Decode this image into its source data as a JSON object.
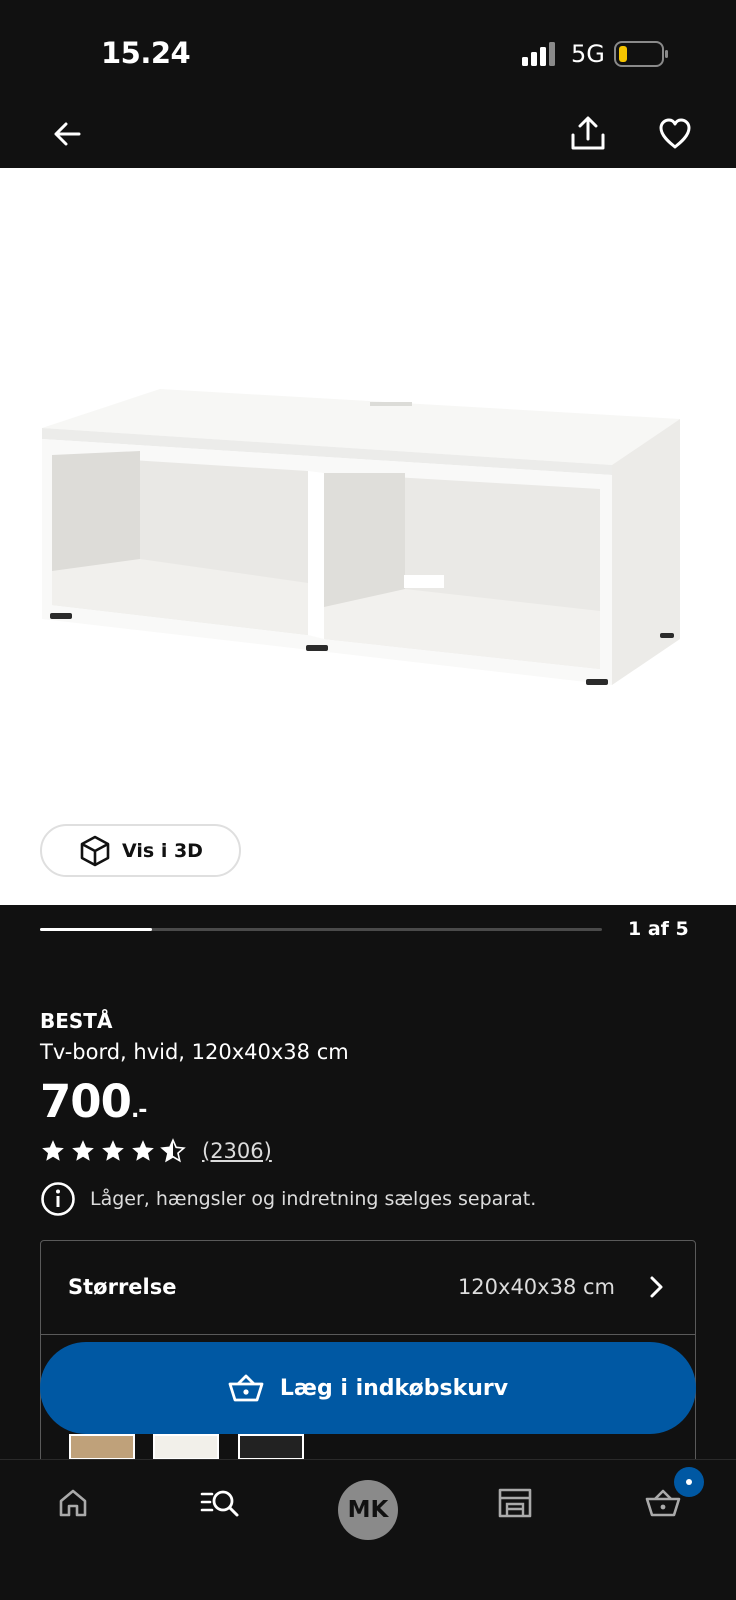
{
  "status_bar": {
    "time": "15.24",
    "network": "5G"
  },
  "gallery": {
    "view_3d_label": "Vis i 3D",
    "page_counter": "1 af 5",
    "progress": 0.2
  },
  "product": {
    "brand": "BESTÅ",
    "description": "Tv-bord, hvid, 120x40x38 cm",
    "price": "700",
    "price_suffix": ".-",
    "rating": 4.5,
    "review_count": "(2306)",
    "notice": "Låger, hængsler og indretning sælges separat."
  },
  "size_selector": {
    "label": "Størrelse",
    "value": "120x40x38 cm"
  },
  "color_swatches": [
    "oak-effect",
    "white",
    "black"
  ],
  "cart_button": {
    "label": "Læg i indkøbskurv"
  },
  "bottom_nav": {
    "avatar_initials": "MK"
  },
  "colors": {
    "background": "#111111",
    "primary_blue": "#0058a3",
    "text": "#ffffff",
    "avatar": "#8a8a8a"
  }
}
